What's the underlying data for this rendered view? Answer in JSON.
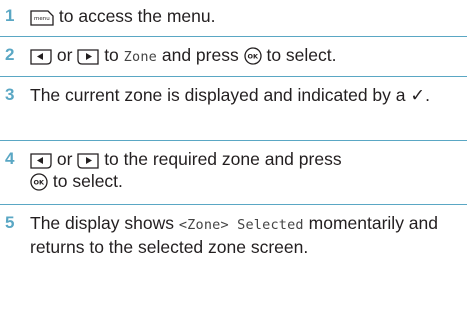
{
  "steps": [
    {
      "number": "1",
      "parts": {
        "text_a": "to access the menu."
      }
    },
    {
      "number": "2",
      "parts": {
        "text_a": "or",
        "text_b": "to",
        "keyword": "Zone",
        "text_c": "and press",
        "text_d": "to select."
      }
    },
    {
      "number": "3",
      "parts": {
        "text_a": "The current zone is displayed and indicated by a",
        "checkmark": "✓",
        "text_b": "."
      }
    },
    {
      "number": "4",
      "parts": {
        "text_a": "or",
        "text_b": "to the required zone and press",
        "text_c": "to select."
      }
    },
    {
      "number": "5",
      "parts": {
        "text_a": "The display shows",
        "keyword": "<Zone> Selected",
        "text_b": "momentarily and returns to the selected zone screen."
      }
    }
  ],
  "icons": {
    "menu_key": "menu-key-icon",
    "left_key": "left-arrow-key-icon",
    "right_key": "right-arrow-key-icon",
    "ok_key": "ok-key-icon"
  },
  "colors": {
    "accent": "#5aa7c4",
    "text": "#231f20"
  }
}
